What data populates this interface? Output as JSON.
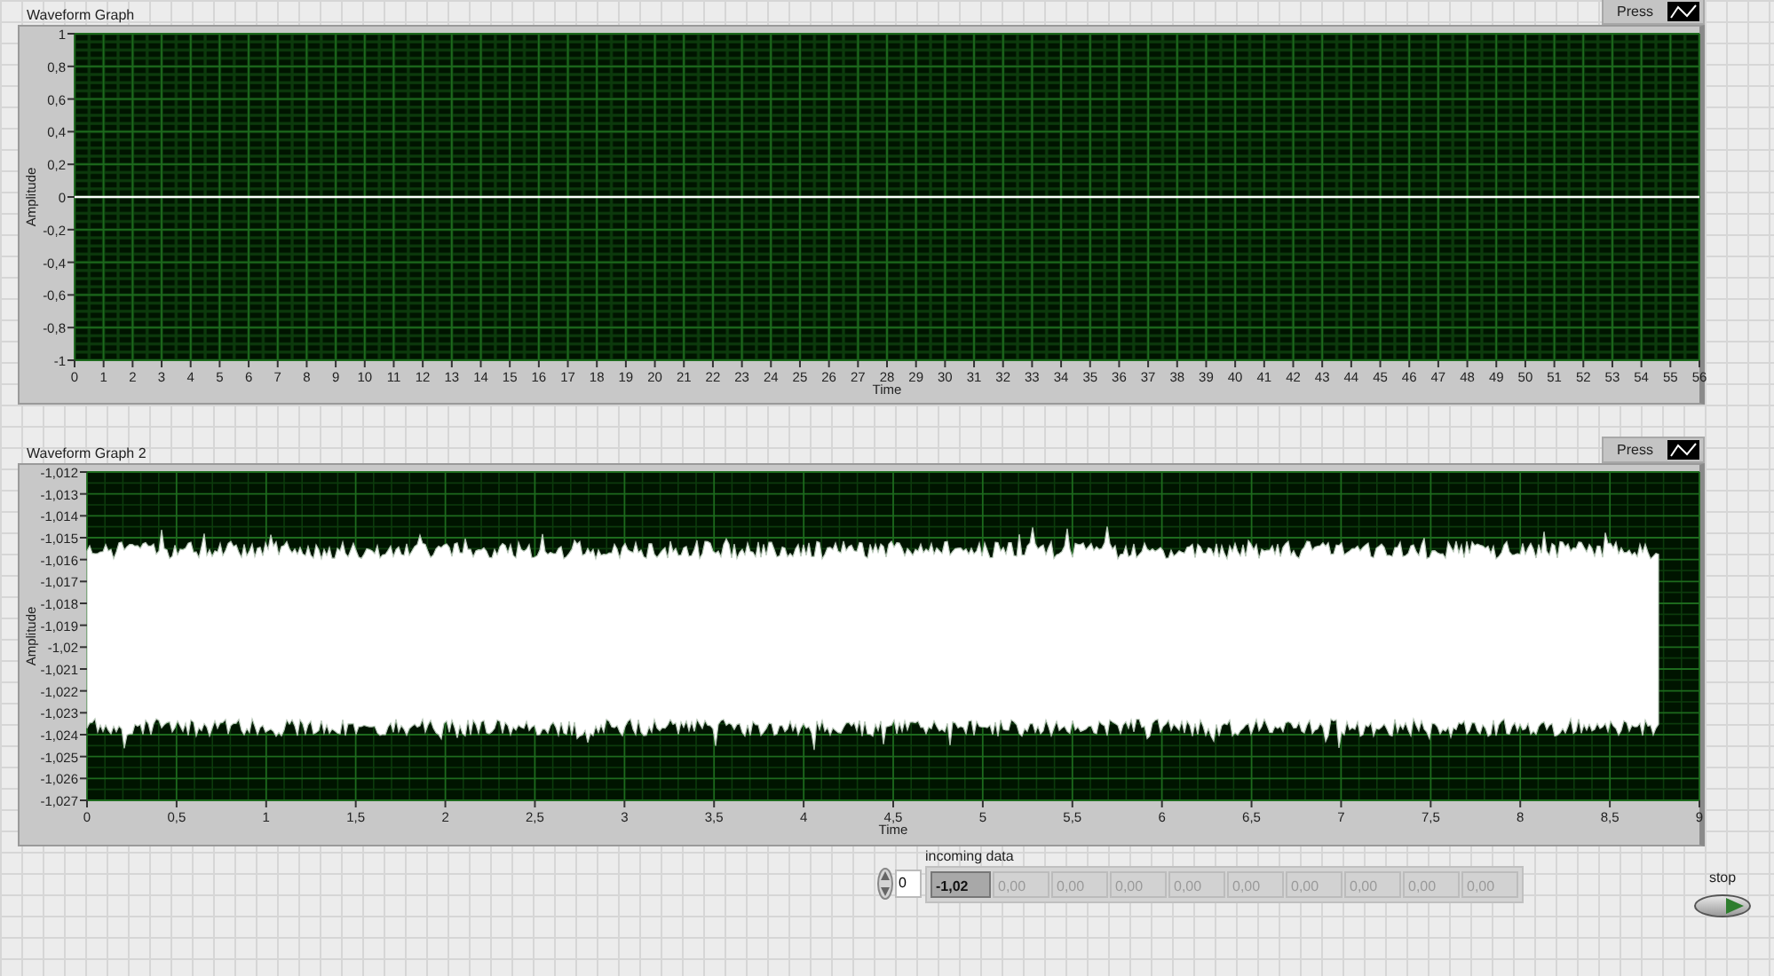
{
  "graph_1": {
    "chart_data": {
      "type": "line",
      "grid": true,
      "title": "Waveform Graph",
      "xlabel": "Time",
      "ylabel": "Amplitude",
      "x": [
        0,
        56
      ],
      "series": [
        {
          "name": "Press",
          "color": "#ffffff",
          "values": [
            0,
            0
          ]
        }
      ],
      "xlim": [
        0,
        56
      ],
      "ylim": [
        -1,
        1
      ],
      "xticks": [
        0,
        1,
        2,
        3,
        4,
        5,
        6,
        7,
        8,
        9,
        10,
        11,
        12,
        13,
        14,
        15,
        16,
        17,
        18,
        19,
        20,
        21,
        22,
        23,
        24,
        25,
        26,
        27,
        28,
        29,
        30,
        31,
        32,
        33,
        34,
        35,
        36,
        37,
        38,
        39,
        40,
        41,
        42,
        43,
        44,
        45,
        46,
        47,
        48,
        49,
        50,
        51,
        52,
        53,
        54,
        55,
        56
      ],
      "yticks": [
        1,
        {
          "value": 0.8,
          "label": "0,8"
        },
        {
          "value": 0.6,
          "label": "0,6"
        },
        {
          "value": 0.4,
          "label": "0,4"
        },
        {
          "value": 0.2,
          "label": "0,2"
        },
        0,
        {
          "value": -0.2,
          "label": "-0,2"
        },
        {
          "value": -0.4,
          "label": "-0,4"
        },
        {
          "value": -0.6,
          "label": "-0,6"
        },
        {
          "value": -0.8,
          "label": "-0,8"
        },
        -1
      ]
    }
  },
  "graph_2": {
    "title": "Waveform Graph 2",
    "legend_label": "Press",
    "ylabel": "Amplitude",
    "xlabel": "Time",
    "y_tick_labels": [
      "-1,012",
      "-1,013",
      "-1,014",
      "-1,015",
      "-1,016",
      "-1,017",
      "-1,018",
      "-1,019",
      "-1,02",
      "-1,021",
      "-1,022",
      "-1,023",
      "-1,024",
      "-1,025",
      "-1,026",
      "-1,027"
    ],
    "x_tick_labels": [
      "0",
      "0,5",
      "1",
      "1,5",
      "2",
      "2,5",
      "3",
      "3,5",
      "4",
      "4,5",
      "5",
      "5,5",
      "6",
      "6,5",
      "7",
      "7,5",
      "8",
      "8,5",
      "9"
    ]
  },
  "array": {
    "label": "incoming data",
    "index": "0",
    "elements": [
      {
        "value": "-1,02",
        "disabled": false
      },
      {
        "value": "0,00",
        "disabled": true
      },
      {
        "value": "0,00",
        "disabled": true
      },
      {
        "value": "0,00",
        "disabled": true
      },
      {
        "value": "0,00",
        "disabled": true
      },
      {
        "value": "0,00",
        "disabled": true
      },
      {
        "value": "0,00",
        "disabled": true
      },
      {
        "value": "0,00",
        "disabled": true
      },
      {
        "value": "0,00",
        "disabled": true
      },
      {
        "value": "0,00",
        "disabled": true
      }
    ]
  },
  "stop": {
    "label": "stop"
  }
}
